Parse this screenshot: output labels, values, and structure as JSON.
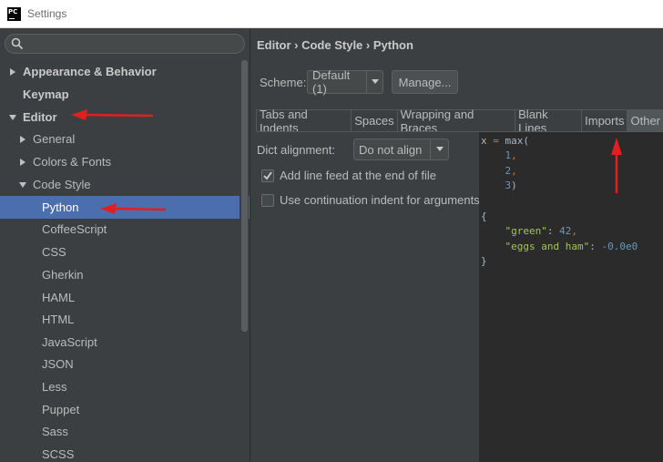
{
  "window": {
    "title": "Settings",
    "app_icon": "PC"
  },
  "search": {
    "placeholder": "",
    "icon": "search-icon"
  },
  "tree": [
    {
      "label": "Appearance & Behavior",
      "bold": true,
      "arrow": "right",
      "indent": 0
    },
    {
      "label": "Keymap",
      "bold": true,
      "arrow": "none",
      "indent": 0
    },
    {
      "label": "Editor",
      "bold": true,
      "arrow": "down",
      "indent": 0
    },
    {
      "label": "General",
      "bold": false,
      "arrow": "right",
      "indent": 1
    },
    {
      "label": "Colors & Fonts",
      "bold": false,
      "arrow": "right",
      "indent": 1
    },
    {
      "label": "Code Style",
      "bold": false,
      "arrow": "down",
      "indent": 1
    },
    {
      "label": "Python",
      "bold": false,
      "arrow": "none",
      "indent": 2,
      "selected": true
    },
    {
      "label": "CoffeeScript",
      "bold": false,
      "arrow": "none",
      "indent": 2
    },
    {
      "label": "CSS",
      "bold": false,
      "arrow": "none",
      "indent": 2
    },
    {
      "label": "Gherkin",
      "bold": false,
      "arrow": "none",
      "indent": 2
    },
    {
      "label": "HAML",
      "bold": false,
      "arrow": "none",
      "indent": 2
    },
    {
      "label": "HTML",
      "bold": false,
      "arrow": "none",
      "indent": 2
    },
    {
      "label": "JavaScript",
      "bold": false,
      "arrow": "none",
      "indent": 2
    },
    {
      "label": "JSON",
      "bold": false,
      "arrow": "none",
      "indent": 2
    },
    {
      "label": "Less",
      "bold": false,
      "arrow": "none",
      "indent": 2
    },
    {
      "label": "Puppet",
      "bold": false,
      "arrow": "none",
      "indent": 2
    },
    {
      "label": "Sass",
      "bold": false,
      "arrow": "none",
      "indent": 2
    },
    {
      "label": "SCSS",
      "bold": false,
      "arrow": "none",
      "indent": 2
    }
  ],
  "breadcrumb": "Editor › Code Style › Python",
  "scheme": {
    "label": "Scheme:",
    "value": "Default (1)",
    "manage_label": "Manage..."
  },
  "tabs": [
    {
      "label": "Tabs and Indents",
      "active": false
    },
    {
      "label": "Spaces",
      "active": false
    },
    {
      "label": "Wrapping and Braces",
      "active": false
    },
    {
      "label": "Blank Lines",
      "active": false
    },
    {
      "label": "Imports",
      "active": false
    },
    {
      "label": "Other",
      "active": true
    }
  ],
  "options": {
    "dict_alignment_label": "Dict alignment:",
    "dict_alignment_value": "Do not align",
    "checkboxes": [
      {
        "label": "Add line feed at the end of file",
        "checked": true
      },
      {
        "label": "Use continuation indent for arguments",
        "checked": false
      }
    ]
  },
  "code": {
    "line1_var": "x",
    "line1_eq": "=",
    "line1_fn": "max(",
    "line2": "1",
    "line3": "2",
    "line4": "3",
    "line4_close": ")",
    "line6": "{",
    "line7_key": "\"green\"",
    "line7_val": "42",
    "line8_key": "\"eggs and ham\"",
    "line8_val": "-0.0e0",
    "line9": "}"
  },
  "colors": {
    "selection": "#4b6eaf",
    "annotation_arrow": "#e02020",
    "number": "#6897bb",
    "string": "#a5c25c",
    "punctuation": "#cc7832"
  }
}
